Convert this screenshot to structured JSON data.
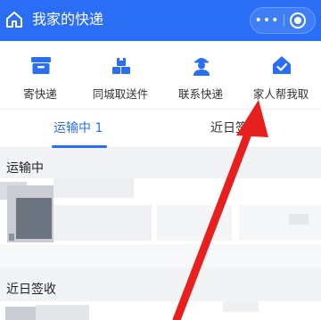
{
  "header": {
    "title": "我家的快递",
    "more_label": "•••"
  },
  "shortcuts": [
    {
      "label": "寄快递",
      "icon": "parcel-box-icon"
    },
    {
      "label": "同城取送件",
      "icon": "boxes-icon"
    },
    {
      "label": "联系快递",
      "icon": "courier-person-icon"
    },
    {
      "label": "家人帮我取",
      "icon": "home-check-icon"
    }
  ],
  "tabs": [
    {
      "label": "运输中 1",
      "active": true
    },
    {
      "label": "近日签收",
      "active": false
    }
  ],
  "sections": {
    "in_transit_title": "运输中",
    "recent_title": "近日签收"
  },
  "colors": {
    "brand": "#2a6ef5",
    "annotation_arrow": "#e81f1f"
  }
}
